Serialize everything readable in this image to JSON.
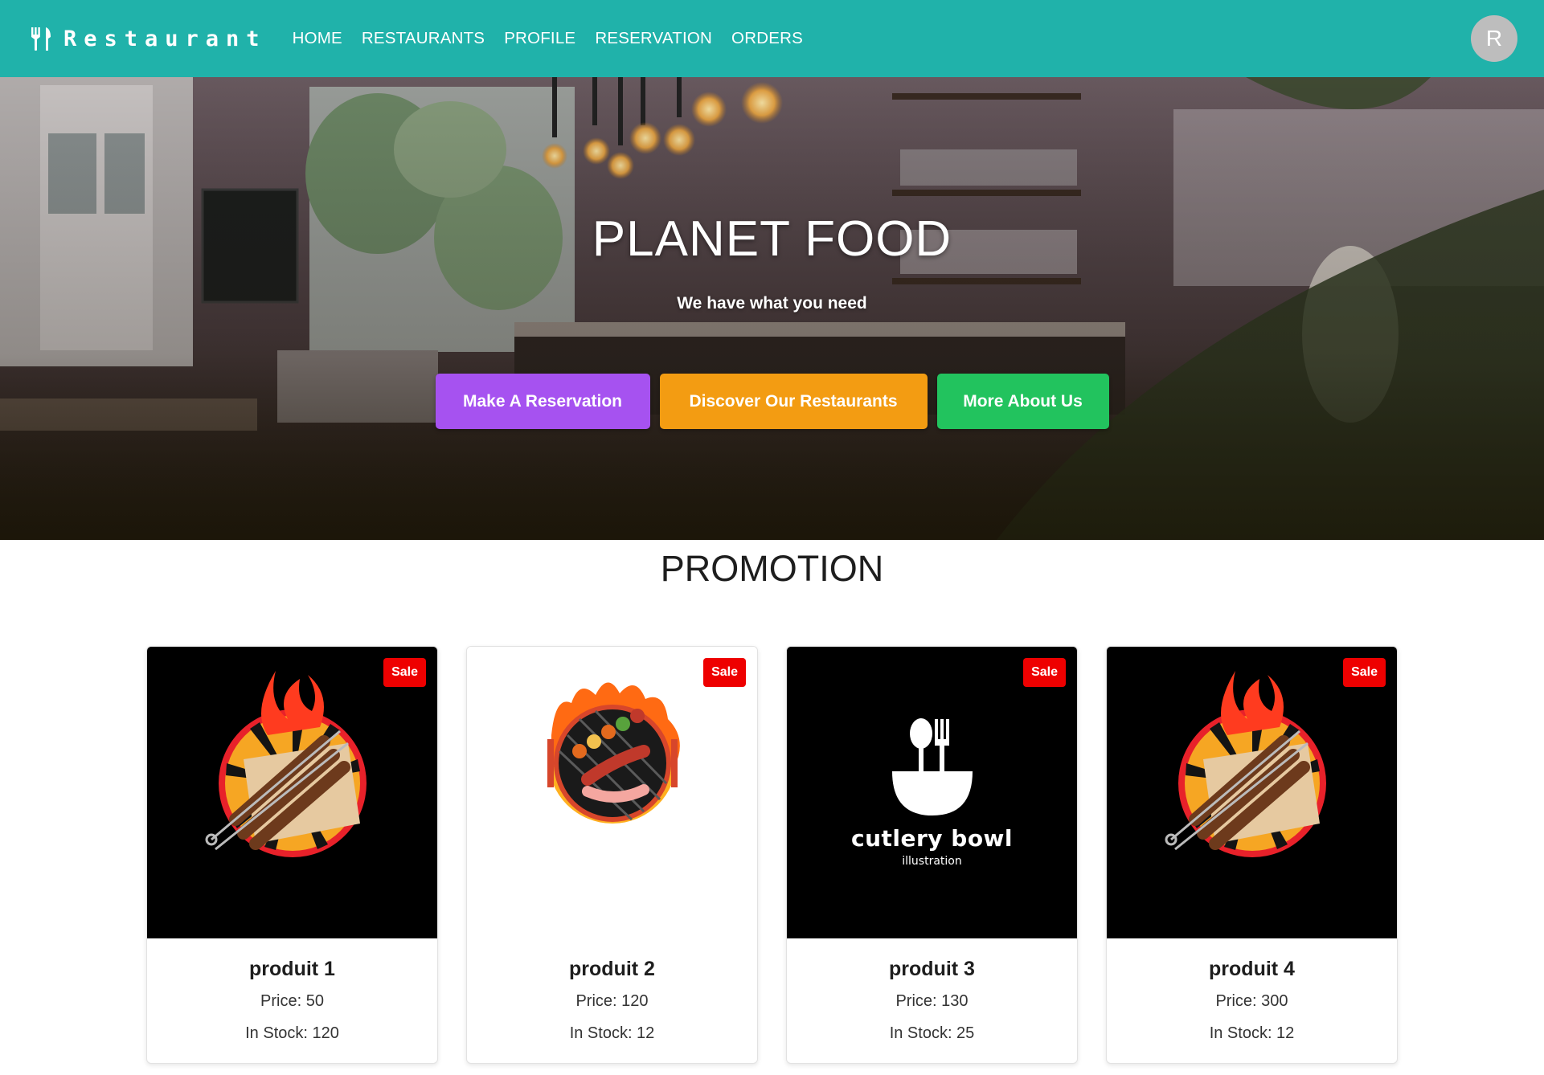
{
  "navbar": {
    "brand": "Restaurant",
    "links": [
      "HOME",
      "RESTAURANTS",
      "PROFILE",
      "RESERVATION",
      "ORDERS"
    ],
    "avatar_initial": "R",
    "background_color": "#20b2aa"
  },
  "hero": {
    "title": "PLANET FOOD",
    "subtitle": "We have what you need",
    "buttons": [
      {
        "label": "Make A Reservation",
        "color": "#a652f0"
      },
      {
        "label": "Discover Our Restaurants",
        "color": "#f39c12"
      },
      {
        "label": "More About Us",
        "color": "#22c35e"
      }
    ]
  },
  "promotion": {
    "title": "PROMOTION",
    "badge": "Sale",
    "products": [
      {
        "name": "produit 1",
        "price": "Price: 50",
        "stock": "In Stock: 120",
        "image": "grill-skewers-logo"
      },
      {
        "name": "produit 2",
        "price": "Price: 120",
        "stock": "In Stock: 12",
        "image": "bbq-grill-flames-logo"
      },
      {
        "name": "produit 3",
        "price": "Price: 130",
        "stock": "In Stock: 25",
        "image": "cutlery-bowl-logo",
        "logo_title": "cutlery bowl",
        "logo_subtitle": "illustration"
      },
      {
        "name": "produit 4",
        "price": "Price: 300",
        "stock": "In Stock: 12",
        "image": "grill-skewers-logo"
      }
    ]
  }
}
